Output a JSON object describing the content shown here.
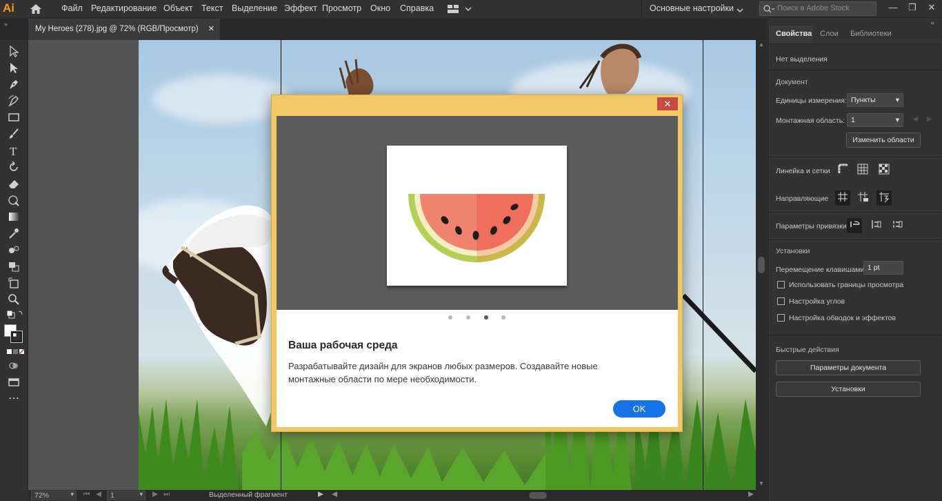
{
  "app": {
    "logo": "Ai"
  },
  "menu": {
    "items": [
      "Файл",
      "Редактирование",
      "Объект",
      "Текст",
      "Выделение",
      "Эффект",
      "Просмотр",
      "Окно",
      "Справка"
    ],
    "workspace": "Основные настройки",
    "search_placeholder": "Поиск в Adobe Stock"
  },
  "document_tab": {
    "title": "My Heroes (278).jpg @ 72% (RGB/Просмотр)"
  },
  "status": {
    "zoom": "72%",
    "artboard": "1",
    "selection": "Выделенный фрагмент"
  },
  "panel": {
    "tabs": [
      "Свойства",
      "Слои",
      "Библиотеки"
    ],
    "no_selection": "Нет выделения",
    "document_section": "Документ",
    "units_label": "Единицы измерения:",
    "units_value": "Пункты",
    "artboard_label": "Монтажная область:",
    "artboard_value": "1",
    "edit_artboards": "Изменить области",
    "rulers_label": "Линейка и сетки",
    "guides_label": "Направляющие",
    "snap_label": "Параметры привязки",
    "prefs_section": "Установки",
    "keyboard_label": "Перемещение клавишами:",
    "keyboard_value": "1 pt",
    "check1": "Использовать границы просмотра",
    "check2": "Настройка углов",
    "check3": "Настройка обводок и эффектов",
    "quick_section": "Быстрые действия",
    "doc_settings_btn": "Параметры документа",
    "prefs_btn": "Установки"
  },
  "dialog": {
    "title": "Ваша рабочая среда",
    "text": "Разрабатывайте дизайн для экранов любых размеров. Создавайте новые монтажные области по мере необходимости.",
    "ok": "OK",
    "close": "✕",
    "pages": 4,
    "active_page": 3
  },
  "colors": {
    "accent": "#1473e6",
    "dialog_frame": "#f2c865",
    "logo": "#ff9a00"
  }
}
